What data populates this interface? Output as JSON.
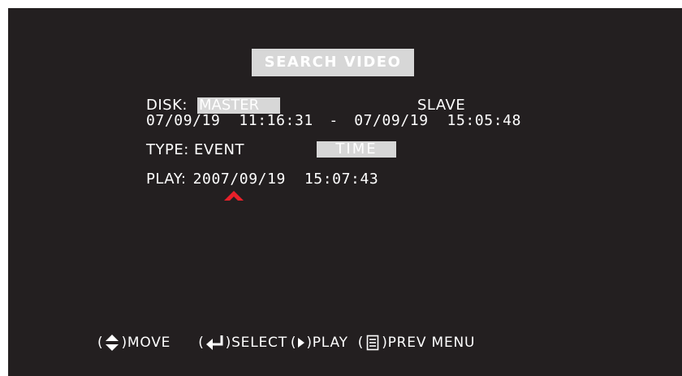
{
  "title": "SEARCH VIDEO",
  "disk": {
    "label": "DISK:",
    "options": [
      "MASTER",
      "SLAVE"
    ],
    "selected": "MASTER",
    "range_start": "07/09/19  11:16:31",
    "range_sep": "-",
    "range_end": "07/09/19  15:05:48"
  },
  "type": {
    "label": "TYPE:",
    "options": [
      "EVENT",
      "TIME"
    ],
    "selected": "TIME"
  },
  "play": {
    "label": "PLAY:",
    "value": "2007/09/19  15:07:43"
  },
  "footer": {
    "move_open": "(",
    "move_close": ")MOVE",
    "select_open": "(",
    "select_close": ")SELECT",
    "play_open": "(",
    "play_close": ")PLAY",
    "prev_open": "(",
    "prev_close": ")PREV MENU"
  },
  "colors": {
    "background": "#231f20",
    "highlight": "#d7d7d7",
    "text": "#ffffff",
    "cursor": "#e8202a"
  },
  "icons": {
    "move": "up-down-arrow-icon",
    "select": "enter-arrow-icon",
    "play": "play-triangle-icon",
    "prev_menu": "menu-list-icon",
    "cursor": "caret-up-icon"
  }
}
